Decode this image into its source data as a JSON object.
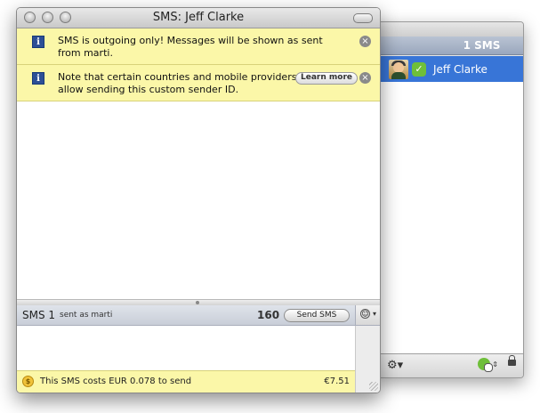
{
  "contact_window": {
    "header": "1 SMS",
    "contacts": [
      {
        "name": "Jeff Clarke",
        "status": "online"
      }
    ],
    "icons": {
      "gear": "gear-icon",
      "presence": "presence-icon",
      "lock": "lock-icon"
    },
    "selection_color": "#3875d7"
  },
  "sms_window": {
    "title": "SMS: Jeff Clarke",
    "notices": [
      {
        "text": "SMS is outgoing only! Messages will be shown as sent from marti."
      },
      {
        "text": "Note that certain countries and mobile providers may not allow sending this custom sender ID.",
        "link_label": "Learn more"
      }
    ],
    "compose": {
      "sms_label": "SMS 1",
      "sent_as": "sent as marti",
      "chars_left": "160",
      "send_label": "Send SMS"
    },
    "cost": {
      "text": "This SMS costs EUR 0.078 to send",
      "balance": "€7.51"
    },
    "notice_color": "#fbf7a8"
  }
}
